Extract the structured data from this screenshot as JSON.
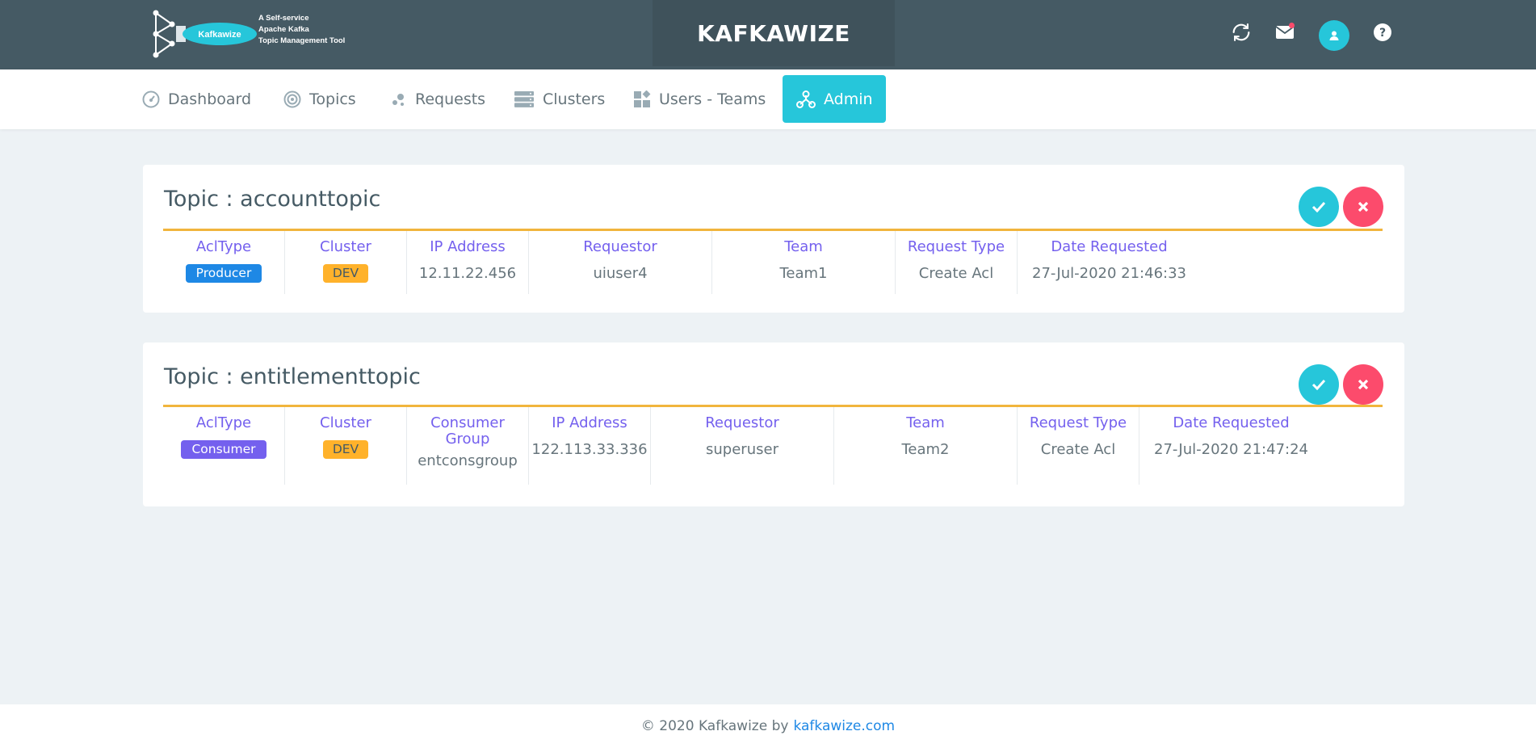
{
  "header": {
    "logo_text": "Kafkawize",
    "tagline": [
      "A Self-service",
      "Apache Kafka",
      "Topic Management Tool"
    ],
    "brand": "KAFKAWIZE",
    "icons": [
      "refresh-icon",
      "mail-icon",
      "user-icon",
      "help-icon"
    ]
  },
  "nav": {
    "items": [
      {
        "label": "Dashboard",
        "icon": "dashboard-icon"
      },
      {
        "label": "Topics",
        "icon": "target-icon"
      },
      {
        "label": "Requests",
        "icon": "bubbles-icon"
      },
      {
        "label": "Clusters",
        "icon": "server-icon"
      },
      {
        "label": "Users - Teams",
        "icon": "widgets-icon"
      },
      {
        "label": "Admin",
        "icon": "network-icon",
        "active": true
      }
    ]
  },
  "requests": [
    {
      "title": "Topic : accounttopic",
      "headers": {
        "acltype": "AclType",
        "cluster": "Cluster",
        "ip": "IP Address",
        "requestor": "Requestor",
        "team": "Team",
        "request_type": "Request Type",
        "date": "Date Requested"
      },
      "acltype": "Producer",
      "cluster": "DEV",
      "ip": "12.11.22.456",
      "requestor": "uiuser4",
      "team": "Team1",
      "request_type": "Create Acl",
      "date": "27-Jul-2020 21:46:33"
    },
    {
      "title": "Topic : entitlementtopic",
      "headers": {
        "acltype": "AclType",
        "cluster": "Cluster",
        "consumer_group": "Consumer Group",
        "ip": "IP Address",
        "requestor": "Requestor",
        "team": "Team",
        "request_type": "Request Type",
        "date": "Date Requested"
      },
      "acltype": "Consumer",
      "cluster": "DEV",
      "consumer_group": "entconsgroup",
      "ip": "122.113.33.336",
      "requestor": "superuser",
      "team": "Team2",
      "request_type": "Create Acl",
      "date": "27-Jul-2020 21:47:24"
    }
  ],
  "footer": {
    "copyright": "© 2020 Kafkawize by",
    "link": "kafkawize.com"
  },
  "colors": {
    "header_bg": "#455a64",
    "accent": "#26c6da",
    "danger": "#fc4b6c",
    "heading": "#7460ee",
    "divider": "#f1b53d",
    "badge_producer": "#1e88e5",
    "badge_dev": "#ffb22b"
  }
}
